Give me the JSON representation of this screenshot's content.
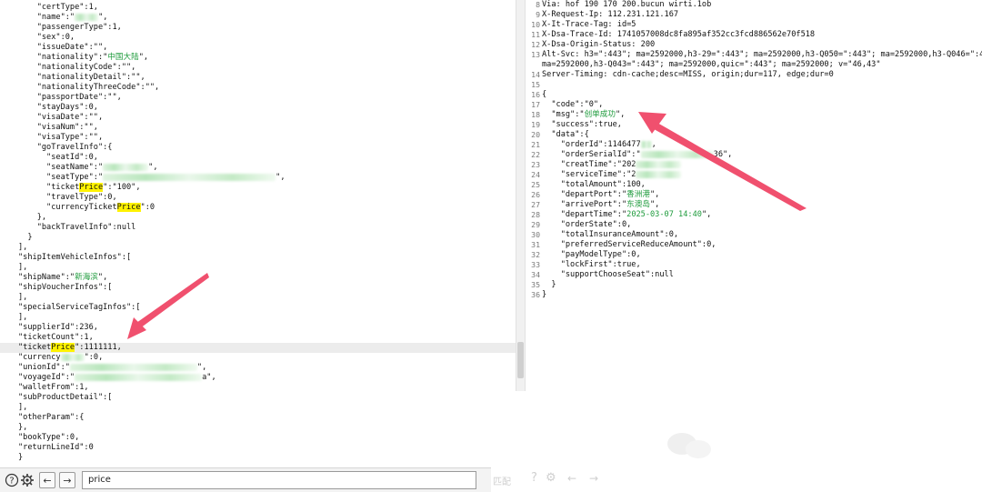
{
  "left_code": [
    {
      "n": "",
      "html": "    \"certType\":1,"
    },
    {
      "n": "",
      "html": "    \"name\":\"<span class='blur' style='width:26px'></span>\","
    },
    {
      "n": "",
      "html": "    \"passengerType\":1,"
    },
    {
      "n": "",
      "html": "    \"sex\":0,"
    },
    {
      "n": "",
      "html": "    \"issueDate\":\"\","
    },
    {
      "n": "",
      "html": "    \"nationality\":\"<span class='t-cn'>中国大陆</span>\","
    },
    {
      "n": "",
      "html": "    \"nationalityCode\":\"\","
    },
    {
      "n": "",
      "html": "    \"nationalityDetail\":\"\","
    },
    {
      "n": "",
      "html": "    \"nationalityThreeCode\":\"\","
    },
    {
      "n": "",
      "html": "    \"passportDate\":\"\","
    },
    {
      "n": "",
      "html": "    \"stayDays\":0,"
    },
    {
      "n": "",
      "html": "    \"visaDate\":\"\","
    },
    {
      "n": "",
      "html": "    \"visaNum\":\"\","
    },
    {
      "n": "",
      "html": "    \"visaType\":\"\","
    },
    {
      "n": "",
      "html": "    \"goTravelInfo\":{"
    },
    {
      "n": "",
      "html": "      \"seatId\":0,"
    },
    {
      "n": "",
      "html": "      \"seatName\":\"<span class='blur' style='width:50px'></span>\","
    },
    {
      "n": "",
      "html": "      \"seatType\":\"<span class='blur' style='width:190px'></span>\","
    },
    {
      "n": "",
      "html": "      \"ticket<span class='mark'>Price</span>\":\"100\","
    },
    {
      "n": "",
      "html": "      \"travelType\":0,"
    },
    {
      "n": "",
      "html": "      \"currencyTicket<span class='mark'>Price</span>\":0"
    },
    {
      "n": "",
      "html": "    },"
    },
    {
      "n": "",
      "html": "    \"backTravelInfo\":null"
    },
    {
      "n": "",
      "html": "  }"
    },
    {
      "n": "",
      "html": "],"
    },
    {
      "n": "",
      "html": "\"shipItemVehicleInfos\":["
    },
    {
      "n": "",
      "html": "],"
    },
    {
      "n": "",
      "html": "\"shipName\":\"<span class='t-cn'>新海滨</span>\","
    },
    {
      "n": "",
      "html": "\"shipVoucherInfos\":["
    },
    {
      "n": "",
      "html": "],"
    },
    {
      "n": "",
      "html": "\"specialServiceTagInfos\":["
    },
    {
      "n": "",
      "html": "],"
    },
    {
      "n": "",
      "html": "\"supplierId\":236,"
    },
    {
      "n": "",
      "html": "\"ticketCount\":1,"
    },
    {
      "n": "",
      "html": "\"ticket<span class='mark'>Price</span>\":1111111,",
      "hl": true
    },
    {
      "n": "",
      "html": "\"currency<span class='blur' style='width:26px'></span>\":0,"
    },
    {
      "n": "",
      "html": "\"unionId\":\"<span class='blur' style='width:140px'></span>\","
    },
    {
      "n": "",
      "html": "\"voyageId\":\"<span class='blur' style='width:140px'></span>a\","
    },
    {
      "n": "",
      "html": "\"walletFrom\":1,"
    },
    {
      "n": "",
      "html": "\"subProductDetail\":["
    },
    {
      "n": "",
      "html": "],"
    },
    {
      "n": "",
      "html": "\"otherParam\":{"
    },
    {
      "n": "",
      "html": "},"
    },
    {
      "n": "",
      "html": "\"bookType\":0,"
    },
    {
      "n": "",
      "html": "\"returnLineId\":0"
    },
    {
      "n": "",
      "html": "}"
    }
  ],
  "right_code": [
    {
      "n": "8",
      "html": "Via: hof 190 170 200.bucun wirti.1ob"
    },
    {
      "n": "9",
      "html": "X-Request-Ip: 112.231.121.167"
    },
    {
      "n": "10",
      "html": "X-It-Trace-Tag: id=5"
    },
    {
      "n": "11",
      "html": "X-Dsa-Trace-Id: 1741057008dc8fa895af352cc3fcd886562e70f518"
    },
    {
      "n": "12",
      "html": "X-Dsa-Origin-Status: 200"
    },
    {
      "n": "13",
      "html": "Alt-Svc: h3=\":443\"; ma=2592000,h3-29=\":443\"; ma=2592000,h3-Q050=\":443\"; ma=2592000,h3-Q046=\":4"
    },
    {
      "n": "",
      "html": "ma=2592000,h3-Q043=\":443\"; ma=2592000,quic=\":443\"; ma=2592000; v=\"46,43\""
    },
    {
      "n": "14",
      "html": "Server-Timing: cdn-cache;desc=MISS, origin;dur=117, edge;dur=0"
    },
    {
      "n": "15",
      "html": ""
    },
    {
      "n": "16",
      "html": "{"
    },
    {
      "n": "17",
      "html": "  \"code\":\"0\","
    },
    {
      "n": "18",
      "html": "  \"msg\":\"<span class='t-cn'>创单成功</span>\","
    },
    {
      "n": "19",
      "html": "  \"success\":true,"
    },
    {
      "n": "20",
      "html": "  \"data\":{"
    },
    {
      "n": "21",
      "html": "    \"orderId\":1146477<span class='blur' style='width:12px'></span>,"
    },
    {
      "n": "22",
      "html": "    \"orderSerialId\":\"<span class='blur' style='width:80px'></span>36\","
    },
    {
      "n": "23",
      "html": "    \"creatTime\":\"202<span class='blur' style='width:50px'></span>"
    },
    {
      "n": "24",
      "html": "    \"serviceTime\":\"2<span class='blur' style='width:50px'></span>"
    },
    {
      "n": "25",
      "html": "    \"totalAmount\":100,"
    },
    {
      "n": "26",
      "html": "    \"departPort\":\"<span class='t-cn'>香洲港</span>\","
    },
    {
      "n": "27",
      "html": "    \"arrivePort\":\"<span class='t-cn'>东澳岛</span>\","
    },
    {
      "n": "28",
      "html": "    \"departTime\":\"<span class='t-cn'>2025-03-07 14:40</span>\","
    },
    {
      "n": "29",
      "html": "    \"orderState\":0,"
    },
    {
      "n": "30",
      "html": "    \"totalInsuranceAmount\":0,"
    },
    {
      "n": "31",
      "html": "    \"preferredServiceReduceAmount\":0,"
    },
    {
      "n": "32",
      "html": "    \"payModelType\":0,"
    },
    {
      "n": "33",
      "html": "    \"lockFirst\":true,"
    },
    {
      "n": "34",
      "html": "    \"supportChooseSeat\":null"
    },
    {
      "n": "35",
      "html": "  }"
    },
    {
      "n": "36",
      "html": "}"
    }
  ],
  "findbar": {
    "query": "price",
    "help_icon": "help-icon",
    "settings_icon": "gear-icon",
    "prev_icon": "arrow-left-icon",
    "next_icon": "arrow-right-icon"
  },
  "ghost_findbar": {
    "label": "匹配"
  },
  "colors": {
    "arrow": "#f0506e",
    "highlight": "#fff200",
    "green_text": "#1e9b3c"
  }
}
